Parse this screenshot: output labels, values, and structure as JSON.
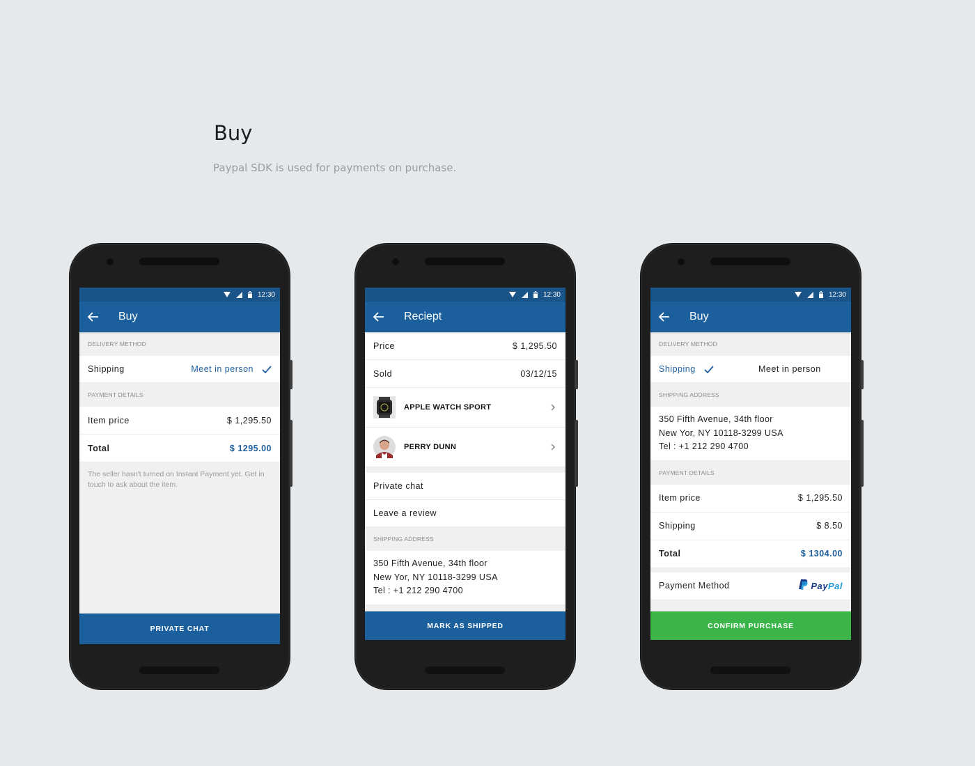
{
  "page": {
    "title": "Buy",
    "subtitle": "Paypal SDK is used for payments on purchase."
  },
  "colors": {
    "primary": "#1c5f9d",
    "statusbar": "#1a5489",
    "confirm_green": "#3bb54a",
    "paypal_dark": "#1a3b87",
    "paypal_light": "#1d9bd7"
  },
  "status_bar": {
    "time": "12:30",
    "icons": [
      "wifi-icon",
      "signal-icon",
      "battery-icon"
    ]
  },
  "screens": [
    {
      "appbar_title": "Buy",
      "delivery_header": "DELIVERY METHOD",
      "delivery_left": "Shipping",
      "delivery_right": "Meet in person",
      "payment_header": "PAYMENT DETAILS",
      "item_price_label": "Item price",
      "item_price_value": "$ 1,295.50",
      "total_label": "Total",
      "total_value": "$ 1295.00",
      "note": "The seller hasn't turned on Instant Payment yet. Get in touch to ask about the item.",
      "button": "PRIVATE CHAT"
    },
    {
      "appbar_title": "Reciept",
      "price_label": "Price",
      "price_value": "$ 1,295.50",
      "sold_label": "Sold",
      "sold_value": "03/12/15",
      "product_name": "APPLE WATCH SPORT",
      "seller_name": "PERRY DUNN",
      "private_chat": "Private chat",
      "leave_review": "Leave a review",
      "shipping_header": "SHIPPING ADDRESS",
      "address_line1": "350 Fifth Avenue, 34th floor",
      "address_line2": "New Yor, NY 10118-3299 USA",
      "address_line3": "Tel : +1 212 290 4700",
      "button": "MARK AS SHIPPED"
    },
    {
      "appbar_title": "Buy",
      "delivery_header": "DELIVERY METHOD",
      "delivery_left": "Shipping",
      "delivery_right": "Meet in person",
      "shipping_header": "SHIPPING ADDRESS",
      "address_line1": "350 Fifth Avenue, 34th floor",
      "address_line2": "New Yor, NY 10118-3299 USA",
      "address_line3": "Tel : +1 212 290 4700",
      "payment_header": "PAYMENT DETAILS",
      "item_price_label": "Item price",
      "item_price_value": "$ 1,295.50",
      "shipping_label": "Shipping",
      "shipping_value": "$ 8.50",
      "total_label": "Total",
      "total_value": "$ 1304.00",
      "payment_method_label": "Payment Method",
      "paypal_pay": "Pay",
      "paypal_pal": "Pal",
      "button": "CONFIRM PURCHASE"
    }
  ]
}
